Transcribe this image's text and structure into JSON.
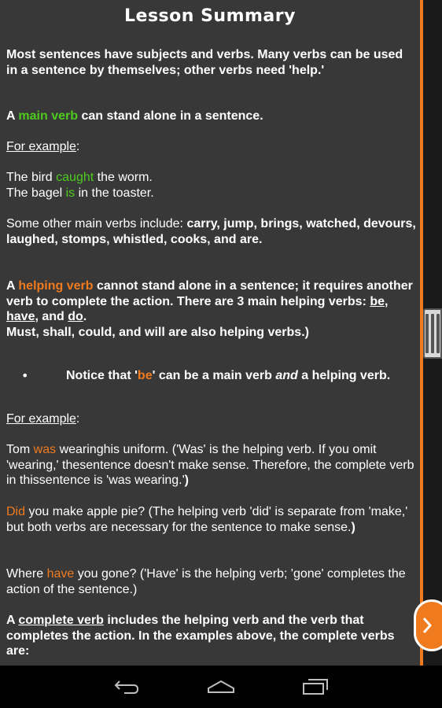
{
  "title": "Lesson Summary",
  "intro": "Most sentences have subjects and verbs. Many verbs can be used in a sentence by themselves; other verbs need 'help.'",
  "main_verb": {
    "a": "A ",
    "term": "main verb",
    "rest": " can stand alone in a sentence."
  },
  "for_example_1": "For example",
  "colon": ":",
  "ex1": {
    "pre": "The bird ",
    "verb": "caught",
    "post": " the worm."
  },
  "ex2": {
    "pre": "The bagel ",
    "verb": "is",
    "post": " in the toaster."
  },
  "other_main": {
    "pre": "Some other main verbs include: ",
    "list": "carry, jump, brings, watched, devours, laughed, stomps, whistled, cooks, and are."
  },
  "helping": {
    "a": "A ",
    "term": "helping verb",
    "rest1": " cannot stand alone in a sentence; it requires another verb to complete the action. There are 3 main helping verbs: ",
    "be": "be",
    "comma1": ", ",
    "have": "have",
    "and": ", and ",
    "do": "do",
    "period": ".",
    "line2": "Must, shall, could, and will are also helping verbs.)"
  },
  "notice": {
    "bullet": "•",
    "pre": "Notice that '",
    "be": "be",
    "mid": "' can be a main verb ",
    "and": "and",
    "post": " a helping verb."
  },
  "for_example_2": "For example",
  "tom": {
    "pre": "Tom ",
    "verb": "was",
    "rest": " wearinghis uniform. ('Was' is the helping verb. If you omit 'wearing,' thesentence doesn't make sense. Therefore, the complete verb in thissentence is 'was wearing.'",
    "close": ")"
  },
  "did": {
    "verb": "Did",
    "rest": " you make apple pie? (The helping verb 'did' is separate from 'make,' but both verbs are necessary for the sentence to make sense.",
    "close": ")"
  },
  "where": {
    "pre": "Where ",
    "verb": "have",
    "rest": " you gone? ('Have' is the helping verb; 'gone' completes the action of the sentence.)"
  },
  "complete": {
    "a": "A ",
    "term": "complete verb",
    "rest": " includes the helping verb and the verb that completes the action. In the examples above, the complete verbs are:"
  },
  "nav": {
    "back_icon": "back-icon",
    "home_icon": "home-icon",
    "recent_icon": "recent-apps-icon"
  },
  "colors": {
    "background": "#383838",
    "accent": "#f07b1f",
    "green": "#4ecb1e"
  }
}
